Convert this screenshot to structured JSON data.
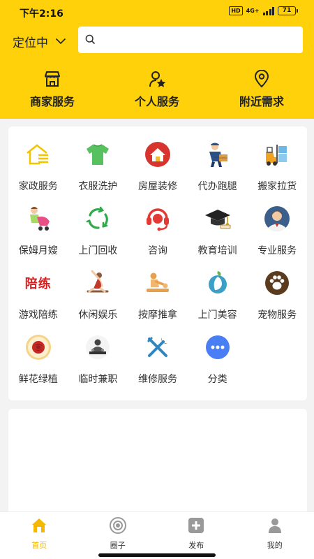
{
  "status_bar": {
    "time": "下午2:16",
    "hd": "HD",
    "network": "4G+",
    "battery": "71"
  },
  "header": {
    "location": "定位中",
    "search": {
      "placeholder": "",
      "value": ""
    },
    "nav": [
      {
        "label": "商家服务",
        "icon": "store-icon"
      },
      {
        "label": "个人服务",
        "icon": "person-star-icon"
      },
      {
        "label": "附近需求",
        "icon": "location-pin-icon"
      }
    ]
  },
  "services": [
    {
      "label": "家政服务",
      "icon": "house-lines-icon",
      "color": "#f2c500"
    },
    {
      "label": "衣服洗护",
      "icon": "tshirt-icon",
      "color": "#57c05f"
    },
    {
      "label": "房屋装修",
      "icon": "house-red-circle-icon",
      "color": "#d8342f"
    },
    {
      "label": "代办跑腿",
      "icon": "courier-icon",
      "color": "#2a4f86"
    },
    {
      "label": "搬家拉货",
      "icon": "forklift-icon",
      "color": "#f0a321"
    },
    {
      "label": "保姆月嫂",
      "icon": "nanny-stroller-icon",
      "color": "#e94f87"
    },
    {
      "label": "上门回收",
      "icon": "recycle-icon",
      "color": "#2faa4b"
    },
    {
      "label": "咨询",
      "icon": "headset-icon",
      "color": "#e53935"
    },
    {
      "label": "教育培训",
      "icon": "graduation-cap-icon",
      "color": "#222222"
    },
    {
      "label": "专业服务",
      "icon": "professional-avatar-icon",
      "color": "#3b5f8a"
    },
    {
      "label": "游戏陪练",
      "icon": "peilian-text-icon",
      "color": "#d81e1e",
      "glyph": "陪练"
    },
    {
      "label": "休闲娱乐",
      "icon": "yoga-icon",
      "color": "#8b5a3c"
    },
    {
      "label": "按摩推拿",
      "icon": "massage-icon",
      "color": "#e8a04c"
    },
    {
      "label": "上门美容",
      "icon": "beauty-face-icon",
      "color": "#3aa0c8"
    },
    {
      "label": "宠物服务",
      "icon": "paw-icon",
      "color": "#5b3b1e"
    },
    {
      "label": "鲜花绿植",
      "icon": "rose-icon",
      "color": "#c62828"
    },
    {
      "label": "临时兼职",
      "icon": "dj-worker-icon",
      "color": "#444444"
    },
    {
      "label": "维修服务",
      "icon": "tools-icon",
      "color": "#2e86c1"
    },
    {
      "label": "分类",
      "icon": "more-dots-icon",
      "color": "#4a7ef5"
    }
  ],
  "tabbar": [
    {
      "label": "首页",
      "icon": "home-icon",
      "active": true
    },
    {
      "label": "圈子",
      "icon": "circle-target-icon",
      "active": false
    },
    {
      "label": "发布",
      "icon": "plus-square-icon",
      "active": false
    },
    {
      "label": "我的",
      "icon": "user-icon",
      "active": false
    }
  ],
  "colors": {
    "brand_yellow": "#fed10a",
    "active_tab": "#f5b800",
    "background": "#f3f3f3"
  }
}
